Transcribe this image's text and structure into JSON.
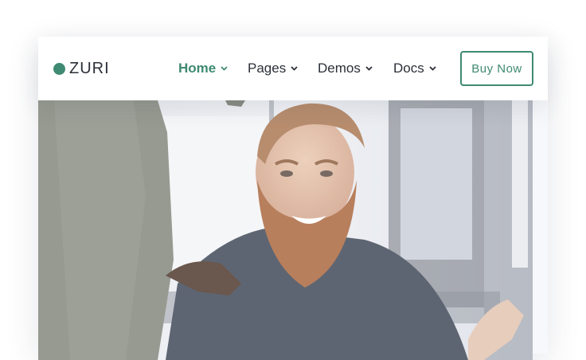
{
  "brand": {
    "name": "ZURI",
    "accent_color": "#3f8a72",
    "logo_icon": "dot-icon"
  },
  "nav": {
    "items": [
      {
        "label": "Home",
        "active": true,
        "icon": "chevron-down-icon"
      },
      {
        "label": "Pages",
        "active": false,
        "icon": "chevron-down-icon"
      },
      {
        "label": "Demos",
        "active": false,
        "icon": "chevron-down-icon"
      },
      {
        "label": "Docs",
        "active": false,
        "icon": "chevron-down-icon"
      }
    ],
    "cta_label": "Buy Now"
  },
  "hero": {
    "image": "smiling-bearded-man-office-photo"
  }
}
